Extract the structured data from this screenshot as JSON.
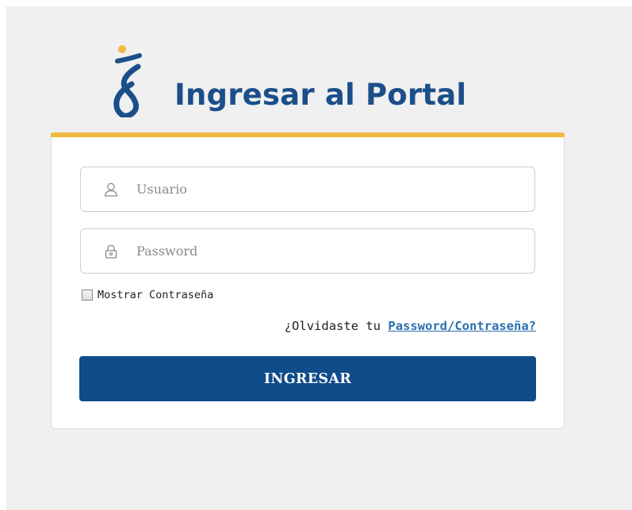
{
  "header": {
    "title": "Ingresar al Portal",
    "logo_icon": "brand-logo-icon"
  },
  "login_form": {
    "username": {
      "icon": "user-icon",
      "placeholder": "Usuario",
      "value": ""
    },
    "password": {
      "icon": "lock-icon",
      "placeholder": "Password",
      "value": ""
    },
    "show_password": {
      "label": "Mostrar Contraseña",
      "checked": false
    },
    "forgot": {
      "prefix": "¿Olvidaste tu ",
      "link_label": "Password/Contraseña?"
    },
    "submit_label": "INGRESAR"
  },
  "colors": {
    "brand_blue": "#1b4f8a",
    "button_blue": "#0f4c8a",
    "accent_yellow": "#f0b941",
    "link_blue": "#2b6fb0",
    "page_background": "#f0f0f0"
  }
}
